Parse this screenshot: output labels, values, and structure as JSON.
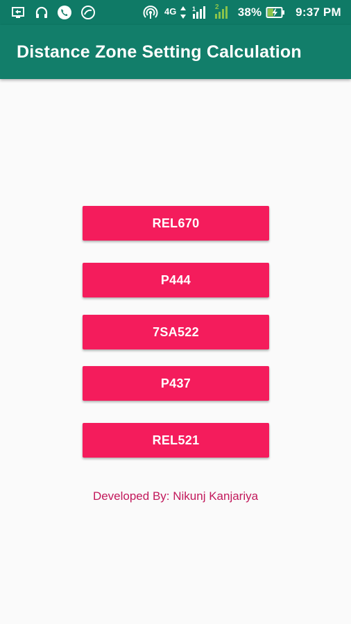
{
  "status_bar": {
    "battery_percent": "38%",
    "time": "9:37 PM",
    "network_type": "4G",
    "sim2_label": "2",
    "icons": [
      "screen-mirror-icon",
      "headphones-icon",
      "phone-call-icon",
      "app-notification-icon",
      "hotspot-icon",
      "network-4g-icon",
      "signal-sim1-icon",
      "signal-sim2-icon",
      "battery-charging-icon"
    ]
  },
  "app_bar": {
    "title": "Distance Zone Setting Calculation"
  },
  "buttons": [
    {
      "label": "REL670"
    },
    {
      "label": "P444"
    },
    {
      "label": "7SA522"
    },
    {
      "label": "P437"
    },
    {
      "label": "REL521"
    }
  ],
  "footer": {
    "credit": "Developed By: Nikunj Kanjariya"
  },
  "colors": {
    "status_bar": "#0f7a66",
    "app_bar": "#127e6a",
    "button": "#f41c5c",
    "button_text": "#ffffff",
    "footer_text": "#c2185b",
    "background": "#fafafa"
  }
}
